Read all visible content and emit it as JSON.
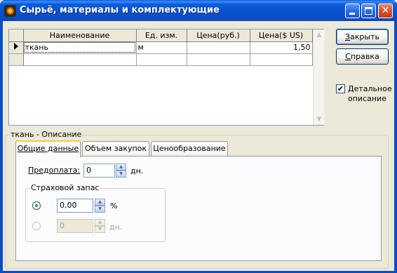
{
  "window": {
    "title": "Сырьё, материалы и комплектующие",
    "controls": {
      "minimize": "_",
      "maximize": "□",
      "close": "✕"
    }
  },
  "grid": {
    "columns": [
      "Наименование",
      "Ед. изм.",
      "Цена(руб.)",
      "Цена($ US)"
    ],
    "rows": [
      {
        "name": "ткань",
        "unit": "м",
        "price_rub": "",
        "price_usd": "1,50"
      },
      {
        "name": "",
        "unit": "",
        "price_rub": "",
        "price_usd": ""
      }
    ],
    "scroll_up": "▲",
    "scroll_down": "▼"
  },
  "buttons": {
    "close_label": "Закрыть",
    "close_hotkey": "З",
    "close_rest": "акрыть",
    "help_label": "Справка",
    "help_hotkey": "С",
    "help_rest": "правка"
  },
  "detail_checkbox": {
    "checked": true,
    "mark": "✔",
    "label_hotkey": "Д",
    "label_rest": "етальное",
    "label_line2": "описание"
  },
  "description_group": {
    "legend": "ткань - Описание",
    "tabs": [
      {
        "label": "Общие данные",
        "active": true
      },
      {
        "label": "Объем закупок",
        "active": false
      },
      {
        "label": "Ценообразование",
        "active": false
      }
    ],
    "prepayment": {
      "label": "Предоплата:",
      "value": "0",
      "unit": "дн."
    },
    "safety_stock": {
      "legend": "Страховой запас",
      "percent_option": {
        "selected": true,
        "value": "0,00",
        "unit": "%"
      },
      "days_option": {
        "selected": false,
        "value": "0",
        "unit": "дн."
      }
    },
    "spin_up": "▲",
    "spin_down": "▼"
  }
}
